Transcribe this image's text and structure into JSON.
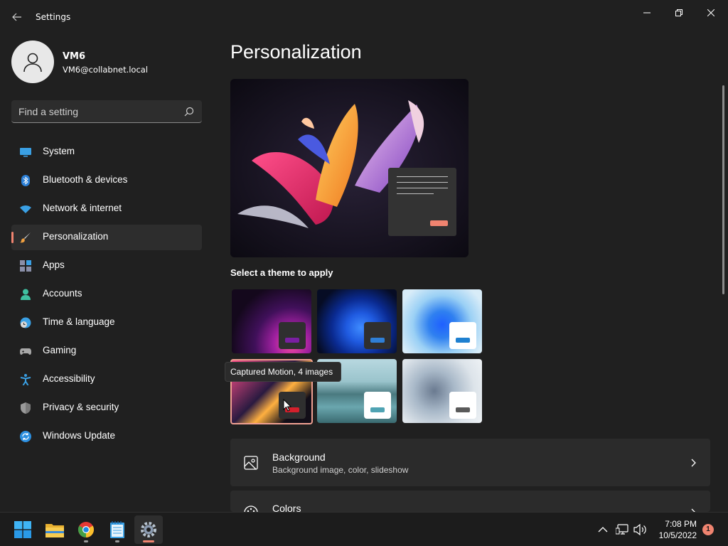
{
  "window": {
    "title": "Settings",
    "back_icon": "back-arrow-icon",
    "controls": [
      "minimize-icon",
      "maximize-icon",
      "close-icon"
    ]
  },
  "user": {
    "name": "VM6",
    "email": "VM6@collabnet.local",
    "avatar_icon": "person-icon"
  },
  "search": {
    "placeholder": "Find a setting",
    "icon": "search-icon"
  },
  "sidebar": {
    "accent_color": "#f08470",
    "items": [
      {
        "label": "System",
        "icon": "monitor-icon",
        "active": false
      },
      {
        "label": "Bluetooth & devices",
        "icon": "bluetooth-icon",
        "active": false
      },
      {
        "label": "Network & internet",
        "icon": "wifi-icon",
        "active": false
      },
      {
        "label": "Personalization",
        "icon": "paintbrush-icon",
        "active": true
      },
      {
        "label": "Apps",
        "icon": "apps-icon",
        "active": false
      },
      {
        "label": "Accounts",
        "icon": "person-icon",
        "active": false
      },
      {
        "label": "Time & language",
        "icon": "globe-clock-icon",
        "active": false
      },
      {
        "label": "Gaming",
        "icon": "gamepad-icon",
        "active": false
      },
      {
        "label": "Accessibility",
        "icon": "accessibility-icon",
        "active": false
      },
      {
        "label": "Privacy & security",
        "icon": "shield-icon",
        "active": false
      },
      {
        "label": "Windows Update",
        "icon": "update-icon",
        "active": false
      }
    ]
  },
  "main": {
    "title": "Personalization",
    "theme_heading": "Select a theme to apply",
    "themes": [
      {
        "name": "theme-glow",
        "selected": false,
        "accent": "#7a1fa2"
      },
      {
        "name": "theme-windows-dark",
        "selected": false,
        "accent": "#2f7fd6"
      },
      {
        "name": "theme-windows-light",
        "selected": false,
        "accent": "#1f80d0"
      },
      {
        "name": "theme-captured-motion",
        "selected": true,
        "accent": "#d4202c"
      },
      {
        "name": "theme-sunrise",
        "selected": false,
        "accent": "#4fa3b3"
      },
      {
        "name": "theme-flow",
        "selected": false,
        "accent": "#5a5a5a"
      }
    ],
    "tooltip": "Captured Motion, 4 images",
    "cards": [
      {
        "title": "Background",
        "subtitle": "Background image, color, slideshow",
        "icon": "image-icon"
      },
      {
        "title": "Colors",
        "subtitle": "",
        "icon": "palette-icon"
      }
    ]
  },
  "taskbar": {
    "apps": [
      {
        "name": "start-button",
        "icon": "windows-logo-icon",
        "running": false,
        "active": false
      },
      {
        "name": "file-explorer",
        "icon": "folder-icon",
        "running": false,
        "active": false
      },
      {
        "name": "chrome",
        "icon": "chrome-icon",
        "running": true,
        "active": false
      },
      {
        "name": "notepad",
        "icon": "notepad-icon",
        "running": true,
        "active": false
      },
      {
        "name": "settings",
        "icon": "gear-icon",
        "running": true,
        "active": true
      }
    ],
    "tray": {
      "icons": [
        "chevron-up-icon",
        "network-icon",
        "volume-icon"
      ],
      "time": "7:08 PM",
      "date": "10/5/2022",
      "notification_count": "1"
    }
  }
}
